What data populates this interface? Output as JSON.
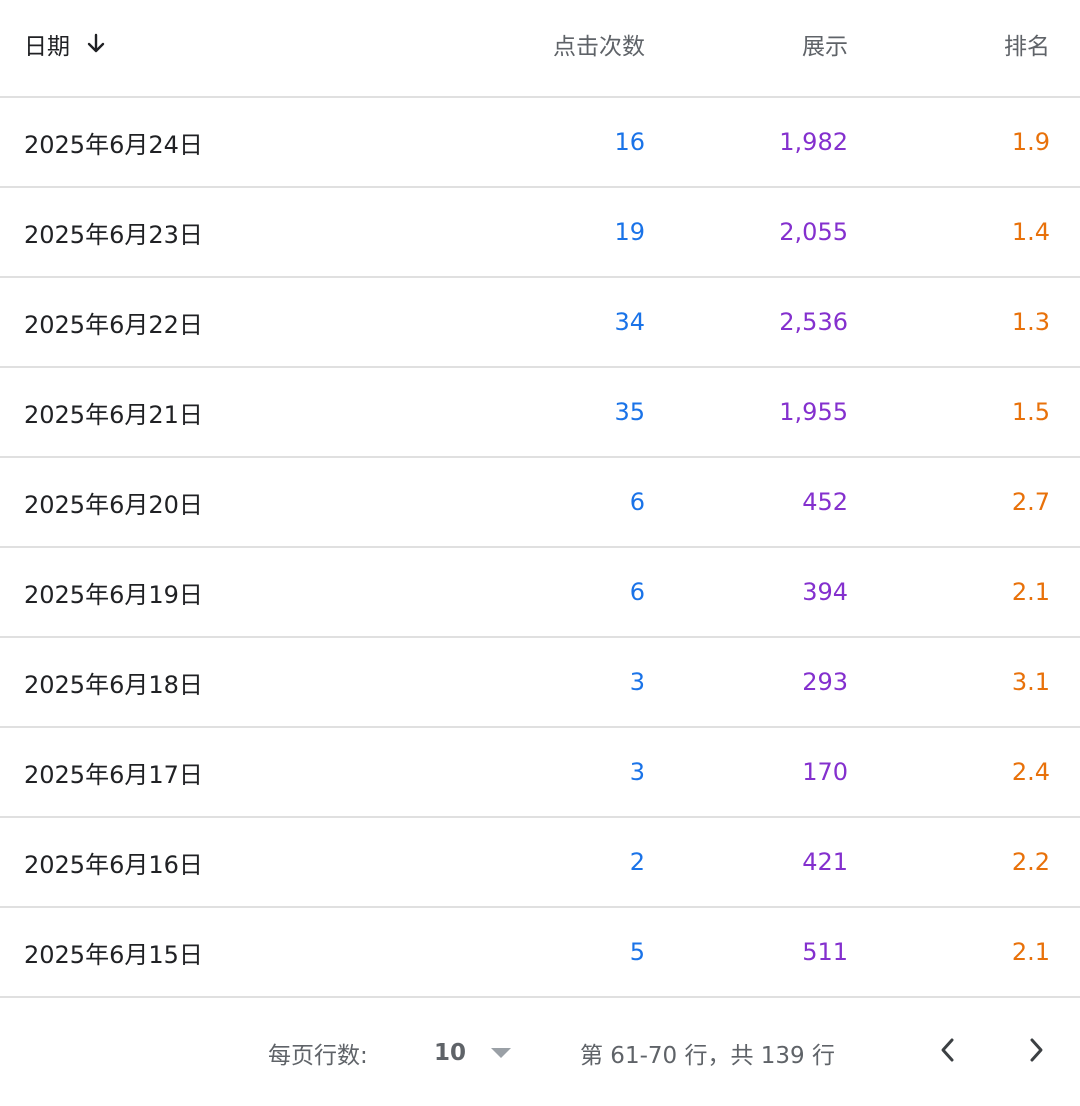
{
  "header": {
    "date": "日期",
    "clicks": "点击次数",
    "impressions": "展示",
    "position": "排名"
  },
  "colors": {
    "clicks": "#1a73e8",
    "impressions": "#8430ce",
    "position": "#e8710a"
  },
  "rows": [
    {
      "date": "2025年6月24日",
      "clicks": "16",
      "impressions": "1,982",
      "position": "1.9"
    },
    {
      "date": "2025年6月23日",
      "clicks": "19",
      "impressions": "2,055",
      "position": "1.4"
    },
    {
      "date": "2025年6月22日",
      "clicks": "34",
      "impressions": "2,536",
      "position": "1.3"
    },
    {
      "date": "2025年6月21日",
      "clicks": "35",
      "impressions": "1,955",
      "position": "1.5"
    },
    {
      "date": "2025年6月20日",
      "clicks": "6",
      "impressions": "452",
      "position": "2.7"
    },
    {
      "date": "2025年6月19日",
      "clicks": "6",
      "impressions": "394",
      "position": "2.1"
    },
    {
      "date": "2025年6月18日",
      "clicks": "3",
      "impressions": "293",
      "position": "3.1"
    },
    {
      "date": "2025年6月17日",
      "clicks": "3",
      "impressions": "170",
      "position": "2.4"
    },
    {
      "date": "2025年6月16日",
      "clicks": "2",
      "impressions": "421",
      "position": "2.2"
    },
    {
      "date": "2025年6月15日",
      "clicks": "5",
      "impressions": "511",
      "position": "2.1"
    }
  ],
  "footer": {
    "rows_per_page_label": "每页行数:",
    "rows_per_page_value": "10",
    "range_text": "第 61-70 行，共 139 行"
  },
  "icons": {
    "sort": "arrow-down-icon",
    "dropdown": "caret-down-icon",
    "prev": "chevron-left-icon",
    "next": "chevron-right-icon"
  }
}
